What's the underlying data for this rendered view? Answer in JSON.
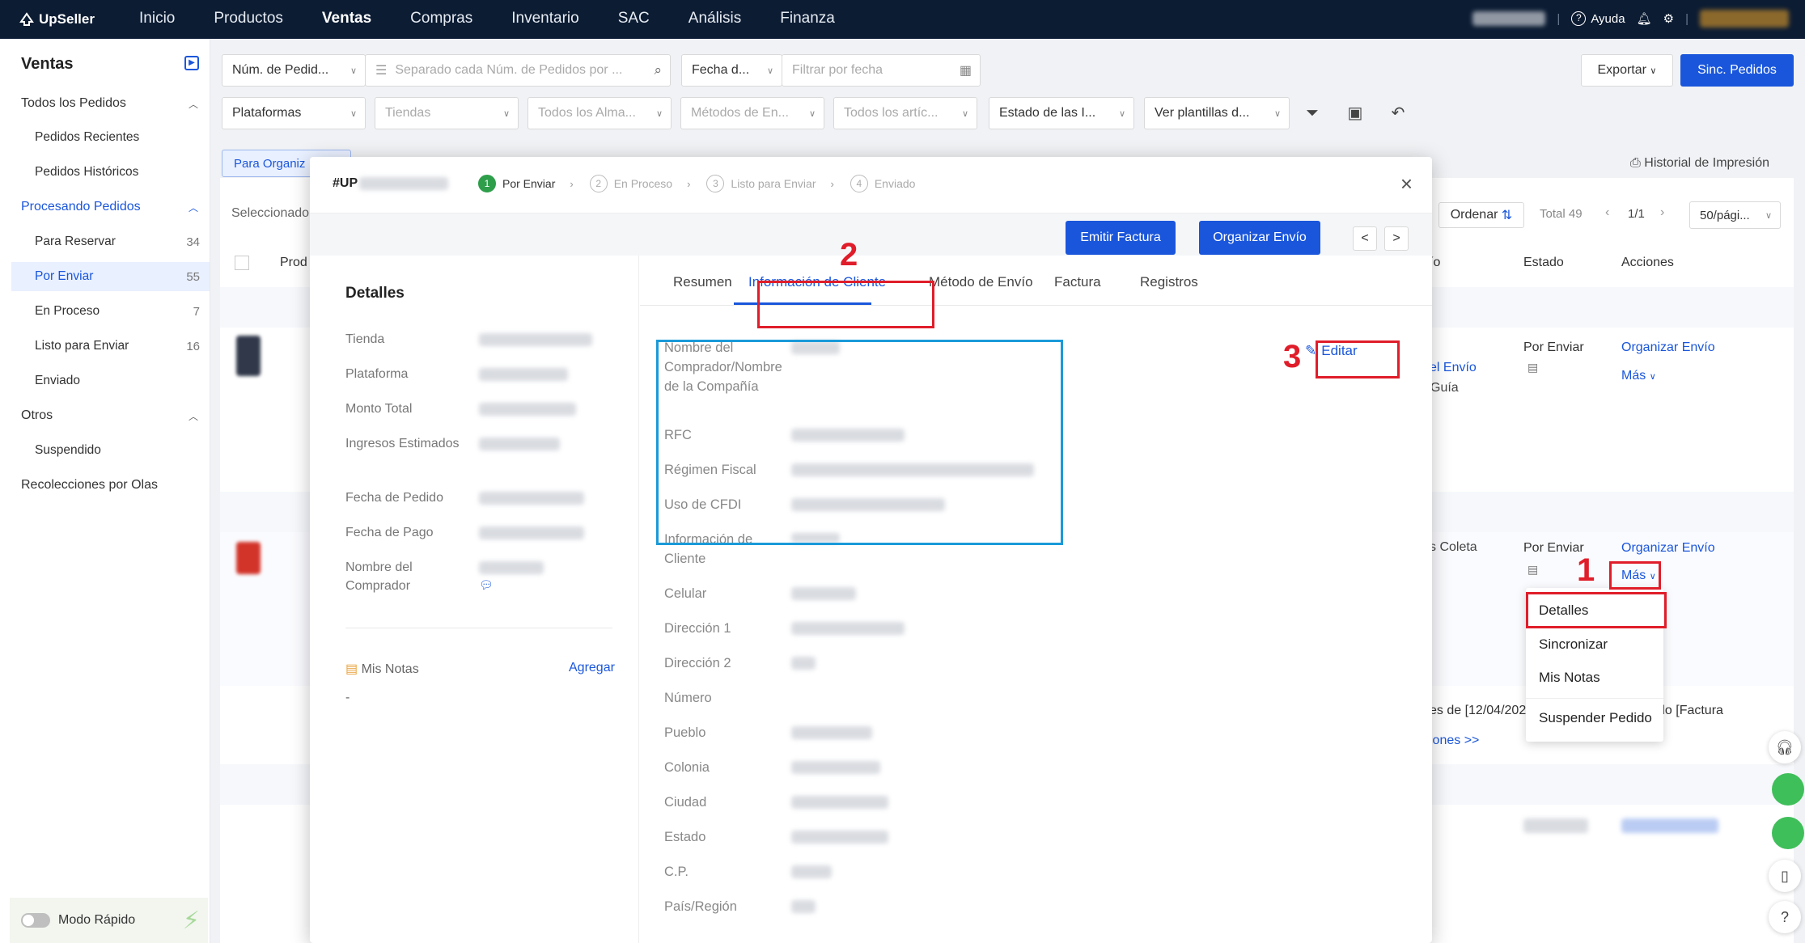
{
  "topbar": {
    "brand": "UpSeller",
    "nav": [
      "Inicio",
      "Productos",
      "Ventas",
      "Compras",
      "Inventario",
      "SAC",
      "Análisis",
      "Finanza"
    ],
    "active_nav": "Ventas",
    "help_label": "Ayuda",
    "help_icon": "question-circle-icon",
    "bell_icon": "bell-icon",
    "gear_icon": "gear-icon"
  },
  "sidebar": {
    "title": "Ventas",
    "items": [
      {
        "label": "Todos los Pedidos",
        "type": "group"
      },
      {
        "label": "Pedidos Recientes",
        "type": "sub"
      },
      {
        "label": "Pedidos Históricos",
        "type": "sub"
      },
      {
        "label": "Procesando Pedidos",
        "type": "group"
      },
      {
        "label": "Para Reservar",
        "type": "sub",
        "count": "34"
      },
      {
        "label": "Por Enviar",
        "type": "sub",
        "count": "55"
      },
      {
        "label": "En Proceso",
        "type": "sub",
        "count": "7"
      },
      {
        "label": "Listo para Enviar",
        "type": "sub",
        "count": "16"
      },
      {
        "label": "Enviado",
        "type": "sub"
      },
      {
        "label": "Otros",
        "type": "group"
      },
      {
        "label": "Suspendido",
        "type": "sub"
      },
      {
        "label": "Recolecciones por Olas",
        "type": "group"
      }
    ],
    "modo_rapido": "Modo Rápido"
  },
  "filters": {
    "num_pedido": "Núm. de Pedid...",
    "search_placeholder": "Separado cada Núm. de Pedidos por ...",
    "fecha": "Fecha d...",
    "fecha_placeholder": "Filtrar por fecha",
    "exportar": "Exportar",
    "sinc": "Sinc. Pedidos",
    "plataformas": "Plataformas",
    "tiendas": "Tiendas",
    "almacenes": "Todos los Alma...",
    "metodos": "Métodos de En...",
    "articulos": "Todos los artíc...",
    "estado": "Estado de las I...",
    "plantillas": "Ver plantillas d..."
  },
  "background": {
    "para_organizar": "Para Organiz",
    "historial": "Historial de Impresión",
    "seleccionado": "Seleccionado",
    "product_col": "Prod",
    "ordenar": "Ordenar",
    "total": "Total 49",
    "pages": "1/1",
    "per_page": "50/pági...",
    "col_envio": "ío",
    "col_estado": "Estado",
    "col_acciones": "Acciones",
    "row1": {
      "shipping": "el Envío",
      "guia": "Guía",
      "estado": "Por Enviar",
      "action": "Organizar Envío",
      "mas": "Más"
    },
    "row2": {
      "shipping": "s Coleta",
      "estado": "Por Enviar",
      "action": "Organizar Envío",
      "mas": "Más"
    },
    "note1": "es de [12/04/202",
    "note2": "do [Factura",
    "note_link": "iones >>"
  },
  "modal": {
    "order_prefix": "#UP",
    "steps": [
      {
        "num": "1",
        "label": "Por Enviar"
      },
      {
        "num": "2",
        "label": "En Proceso"
      },
      {
        "num": "3",
        "label": "Listo para Enviar"
      },
      {
        "num": "4",
        "label": "Enviado"
      }
    ],
    "emitir": "Emitir Factura",
    "organizar": "Organizar Envío",
    "prev": "<",
    "next": ">",
    "detalles_title": "Detalles",
    "detalles": [
      {
        "label": "Tienda"
      },
      {
        "label": "Plataforma"
      },
      {
        "label": "Monto Total"
      },
      {
        "label": "Ingresos Estimados"
      },
      {
        "label": "Fecha de Pedido"
      },
      {
        "label": "Fecha de Pago"
      },
      {
        "label": "Nombre del Comprador"
      }
    ],
    "mis_notas": "Mis Notas",
    "agregar": "Agregar",
    "notas_value": "-",
    "tabs": [
      "Resumen",
      "Información de Cliente",
      "Método de Envío",
      "Factura",
      "Registros"
    ],
    "active_tab": "Información de Cliente",
    "editar": "Editar",
    "cliente_fields": [
      {
        "label": "Nombre del Comprador/Nombre de la Compañía"
      },
      {
        "label": "RFC"
      },
      {
        "label": "Régimen Fiscal"
      },
      {
        "label": "Uso de CFDI"
      },
      {
        "label": "Información de Cliente"
      },
      {
        "label": "Celular"
      },
      {
        "label": "Dirección 1"
      },
      {
        "label": "Dirección 2"
      },
      {
        "label": "Número"
      },
      {
        "label": "Pueblo"
      },
      {
        "label": "Colonia"
      },
      {
        "label": "Ciudad"
      },
      {
        "label": "Estado"
      },
      {
        "label": "C.P."
      },
      {
        "label": "País/Región"
      }
    ]
  },
  "dropdown": [
    "Detalles",
    "Sincronizar",
    "Mis Notas",
    "Suspender Pedido"
  ],
  "annotations": {
    "n1": "1",
    "n2": "2",
    "n3": "3"
  },
  "colors": {
    "accent": "#1a56db",
    "annotation_red": "#e01d2a",
    "annotation_blue": "#1a9ad9",
    "topbar": "#0c1c33"
  }
}
